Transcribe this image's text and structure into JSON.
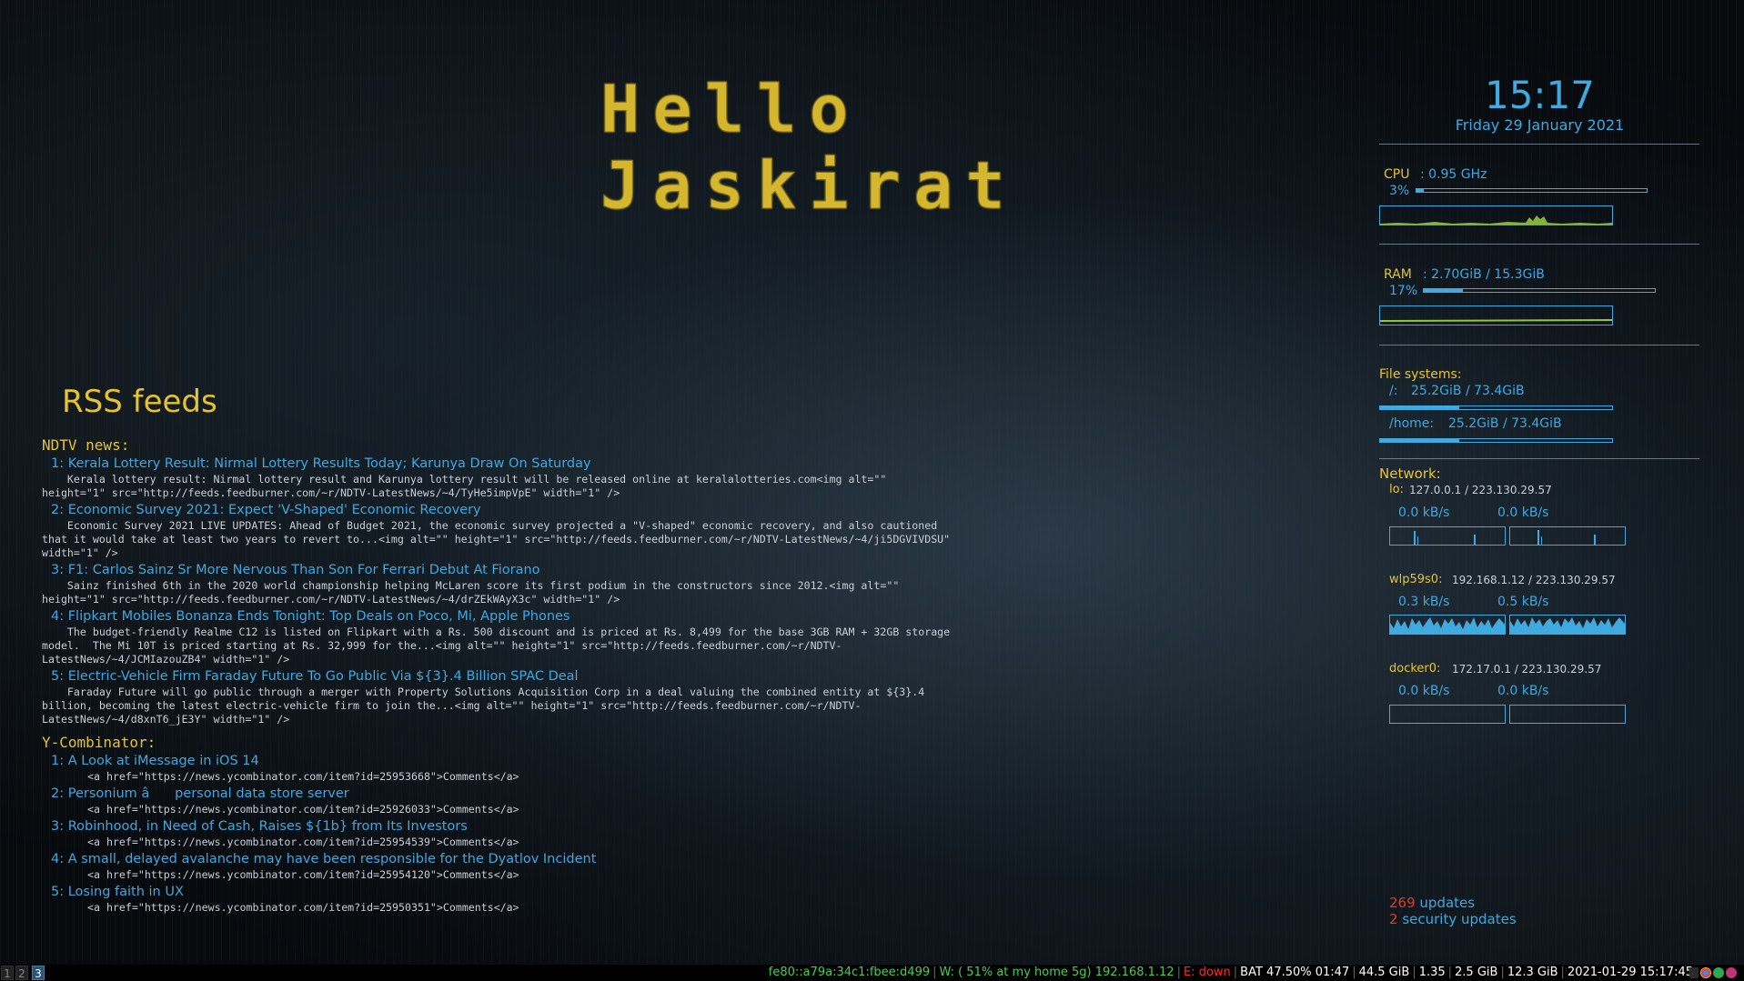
{
  "greeting": "Hello Jaskirat",
  "rss": {
    "title": "RSS feeds",
    "sections": [
      {
        "heading": "NDTV news:",
        "items": [
          {
            "title": "1: Kerala Lottery Result: Nirmal Lottery Results Today; Karunya Draw On Saturday",
            "desc": "    Kerala lottery result: Nirmal lottery result and Karunya lottery result will be released online at keralalotteries.com<img alt=\"\" height=\"1\" src=\"http://feeds.feedburner.com/~r/NDTV-LatestNews/~4/TyHe5impVpE\" width=\"1\" />"
          },
          {
            "title": "2: Economic Survey 2021: Expect 'V-Shaped' Economic Recovery",
            "desc": "    Economic Survey 2021 LIVE UPDATES: Ahead of Budget 2021, the economic survey projected a \"V-shaped\" economic recovery, and also cautioned that it would take at least two years to revert to...<img alt=\"\" height=\"1\" src=\"http://feeds.feedburner.com/~r/NDTV-LatestNews/~4/ji5DGVIVDSU\" width=\"1\" />"
          },
          {
            "title": "3: F1: Carlos Sainz Sr More Nervous Than Son For Ferrari Debut At Fiorano",
            "desc": "    Sainz finished 6th in the 2020 world championship helping McLaren score its first podium in the constructors since 2012.<img alt=\"\" height=\"1\" src=\"http://feeds.feedburner.com/~r/NDTV-LatestNews/~4/drZEkWAyX3c\" width=\"1\" />"
          },
          {
            "title": "4: Flipkart Mobiles Bonanza Ends Tonight: Top Deals on Poco, Mi, Apple Phones",
            "desc": "    The budget-friendly Realme C12 is listed on Flipkart with a Rs. 500 discount and is priced at Rs. 8,499 for the base 3GB RAM + 32GB storage model.  The Mi 10T is priced starting at Rs. 32,999 for the...<img alt=\"\" height=\"1\" src=\"http://feeds.feedburner.com/~r/NDTV-LatestNews/~4/JCMIazouZB4\" width=\"1\" />"
          },
          {
            "title": "5: Electric-Vehicle Firm Faraday Future To Go Public Via ${3}.4 Billion SPAC Deal",
            "desc": "    Faraday Future will go public through a merger with Property Solutions Acquisition Corp in a deal valuing the combined entity at ${3}.4 billion, becoming the latest electric-vehicle firm to join the...<img alt=\"\" height=\"1\" src=\"http://feeds.feedburner.com/~r/NDTV-LatestNews/~4/d8xnT6_jE3Y\" width=\"1\" />"
          }
        ]
      },
      {
        "heading": "Y-Combinator:",
        "items": [
          {
            "title": "1: A Look at iMessage in iOS 14",
            "desc": "<a href=\"https://news.ycombinator.com/item?id=25953668\">Comments</a>"
          },
          {
            "title": "2: Personium â personal data store server",
            "desc": "<a href=\"https://news.ycombinator.com/item?id=25926033\">Comments</a>"
          },
          {
            "title": "3: Robinhood, in Need of Cash, Raises ${1b} from Its Investors",
            "desc": "<a href=\"https://news.ycombinator.com/item?id=25954539\">Comments</a>"
          },
          {
            "title": "4: A small, delayed avalanche may have been responsible for the Dyatlov Incident",
            "desc": "<a href=\"https://news.ycombinator.com/item?id=25954120\">Comments</a>"
          },
          {
            "title": "5: Losing faith in UX",
            "desc": "<a href=\"https://news.ycombinator.com/item?id=25950351\">Comments</a>"
          }
        ]
      }
    ]
  },
  "conky": {
    "time": "15:17",
    "date": "Friday 29 January 2021",
    "cpu": {
      "label": "CPU",
      "value": ": 0.95 GHz",
      "percent_label": "3%",
      "percent": 0.03
    },
    "ram": {
      "label": "RAM",
      "value": ": 2.70GiB / 15.3GiB",
      "percent_label": "17%",
      "percent": 0.17
    },
    "fs": {
      "label": "File systems:",
      "root": {
        "mount": "/:",
        "usage": "25.2GiB / 73.4GiB",
        "fraction": 0.34
      },
      "home": {
        "mount": "/home:",
        "usage": "25.2GiB / 73.4GiB",
        "fraction": 0.34
      }
    },
    "network": {
      "label": "Network:",
      "ifaces": [
        {
          "name": "lo:",
          "addr": "127.0.0.1 / 223.130.29.57",
          "down": "0.0 kB/s",
          "up": "0.0 kB/s"
        },
        {
          "name": "wlp59s0:",
          "addr": "192.168.1.12 / 223.130.29.57",
          "down": "0.3 kB/s",
          "up": "0.5 kB/s"
        },
        {
          "name": "docker0:",
          "addr": "172.17.0.1 / 223.130.29.57",
          "down": "0.0 kB/s",
          "up": "0.0 kB/s"
        }
      ]
    },
    "updates": {
      "count": "269",
      "label": "updates",
      "security_count": "2",
      "security_label": "security updates"
    }
  },
  "statusbar": {
    "workspaces": [
      "1",
      "2",
      "3"
    ],
    "active_workspace": "3",
    "ipv6": "fe80::a79a:34c1:fbee:d499",
    "wifi": "W: ( 51% at my home 5g) 192.168.1.12",
    "ethernet": "E: down",
    "battery": "BAT 47.50% 01:47",
    "disk": "44.5 GiB",
    "load": "1.35",
    "mem_used": "2.5 GiB",
    "mem_free": "12.3 GiB",
    "datetime": "2021-01-29 15:17:45"
  },
  "colors": {
    "accent": "#3fa9e0",
    "heading": "#e6c431",
    "good": "#3fd44a",
    "bad": "#ff2a2a"
  }
}
